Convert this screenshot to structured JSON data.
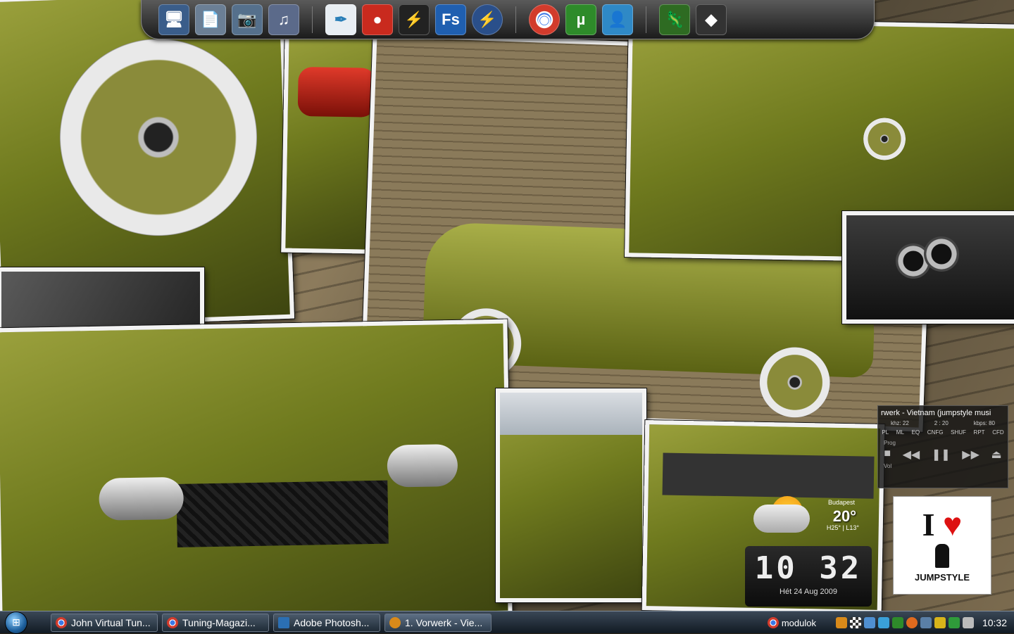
{
  "dock": {
    "icons": [
      {
        "name": "my-computer-icon",
        "glyph": "🖥",
        "color": "#3a5d8a"
      },
      {
        "name": "documents-icon",
        "glyph": "📄",
        "color": "#6b7f95"
      },
      {
        "name": "pictures-icon",
        "glyph": "📷",
        "color": "#55708c"
      },
      {
        "name": "music-icon",
        "glyph": "♫",
        "color": "#5b6a8a"
      },
      {
        "name": "feather-icon",
        "glyph": "✒",
        "color": "#e8eef3"
      },
      {
        "name": "nero-icon",
        "glyph": "●",
        "color": "#c92a1e"
      },
      {
        "name": "winamp-icon",
        "glyph": "⚡",
        "color": "#222222"
      },
      {
        "name": "fs-icon",
        "glyph": "Fs",
        "color": "#1f5fb0"
      },
      {
        "name": "download-accelerator-icon",
        "glyph": "⚡",
        "color": "#2a4f8a"
      },
      {
        "name": "chrome-icon",
        "glyph": "◉",
        "color": "#d23b2c"
      },
      {
        "name": "utorrent-icon",
        "glyph": "µ",
        "color": "#2e8b2a"
      },
      {
        "name": "messenger-icon",
        "glyph": "👤",
        "color": "#2f89c6"
      },
      {
        "name": "gecko-icon",
        "glyph": "🦎",
        "color": "#2e6b22"
      },
      {
        "name": "cube-icon",
        "glyph": "◆",
        "color": "#333333"
      }
    ]
  },
  "winamp": {
    "title": "rwerk - Vietnam (jumpstyle musi",
    "khz": "khz: 22",
    "time": "2 : 20",
    "kbps": "kbps: 80",
    "buttons": [
      "PL",
      "ML",
      "EQ",
      "CNFG",
      "SHUF",
      "RPT",
      "CFD"
    ],
    "prog_label": "Prog",
    "vol_label": "Vol",
    "controls": [
      "■",
      "◀◀",
      "❚❚",
      "▶▶",
      "⏏"
    ]
  },
  "jumpstyle": {
    "i": "I",
    "heart": "♥",
    "word": "JUMPSTYLE"
  },
  "weather": {
    "city": "Budapest",
    "temp": "20°",
    "hilo": "H25° | L13°"
  },
  "clock": {
    "time": "10 32",
    "date": "Hét 24 Aug 2009"
  },
  "taskbar": {
    "start_glyph": "⊞",
    "tasks": [
      {
        "label": "John Virtual Tun...",
        "icon": "chrome",
        "color": "#d23b2c"
      },
      {
        "label": "Tuning-Magazi...",
        "icon": "chrome",
        "color": "#d23b2c"
      },
      {
        "label": "Adobe Photosh...",
        "icon": "photoshop",
        "color": "#2b6fb3"
      },
      {
        "label": "1. Vorwerk - Vie...",
        "icon": "winamp",
        "color": "#d98a1a"
      }
    ],
    "tray_label": "modulok",
    "tray_time": "10:32"
  },
  "colors": {
    "taskbar": "#1f2b37",
    "car": "#7a8426"
  }
}
